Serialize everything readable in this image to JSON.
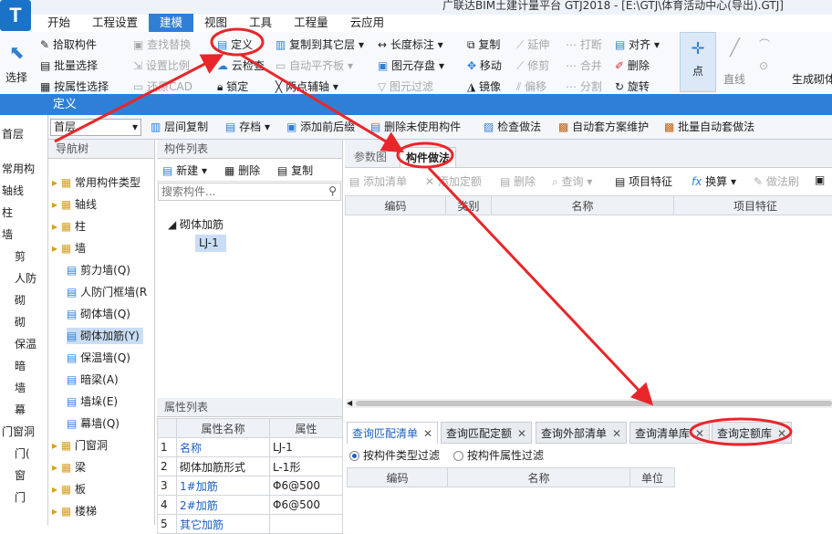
{
  "app": {
    "title_text": "广联达BIM土建计量平台 GTJ2018 - [E:\\GTJ\\体育活动中心(导出).GTJ]",
    "logo_letter": "T"
  },
  "menu": [
    "开始",
    "工程设置",
    "建模",
    "视图",
    "工具",
    "工程量",
    "云应用"
  ],
  "menu_active_index": 2,
  "ribbon": {
    "select_label": "选择",
    "pick_component": "拾取构件",
    "batch_select": "批量选择",
    "select_by_attr": "按属性选择",
    "find_replace": "查找替换",
    "define": "定义",
    "set_ratio": "设置比例",
    "cloud_check": "云检查",
    "restore_cad": "还原CAD",
    "lock": "锁定",
    "copy_to_floor": "复制到其它层",
    "auto_level_board": "自动平齐板",
    "two_point_axis": "两点辅轴",
    "length_mark": "长度标注",
    "element_save": "图元存盘",
    "element_filter": "图元过滤",
    "copy": "复制",
    "extend": "延伸",
    "break": "打断",
    "align": "对齐",
    "move": "移动",
    "trim": "修剪",
    "merge": "合并",
    "delete": "删除",
    "mirror": "镜像",
    "offset": "偏移",
    "split": "分割",
    "rotate": "旋转",
    "point": "点",
    "line": "直线",
    "gen_masonry": "生成砌体"
  },
  "define_bar": "定义",
  "toolbar": {
    "floor": "首层",
    "layer_copy": "层间复制",
    "archive": "存档",
    "add_prefix": "添加前后缀",
    "delete_unused": "删除未使用构件",
    "check_method": "检查做法",
    "auto_scheme": "自动套方案维护",
    "batch_auto": "批量自动套做法"
  },
  "bg_left": [
    "首层",
    "常用构",
    "轴线",
    "柱",
    "墙",
    "剪",
    "人防",
    "砌",
    "砌",
    "保温",
    "暗",
    "墙",
    "幕",
    "门窗洞",
    "门(",
    "窗",
    "门"
  ],
  "nav": {
    "title": "导航树",
    "items": [
      {
        "label": "常用构件类型",
        "level": 0
      },
      {
        "label": "轴线",
        "level": 0
      },
      {
        "label": "柱",
        "level": 0
      },
      {
        "label": "墙",
        "level": 0
      },
      {
        "label": "剪力墙(Q)",
        "level": 1
      },
      {
        "label": "人防门框墙(R",
        "level": 1
      },
      {
        "label": "砌体墙(Q)",
        "level": 1
      },
      {
        "label": "砌体加筋(Y)",
        "level": 1
      },
      {
        "label": "保温墙(Q)",
        "level": 1
      },
      {
        "label": "暗梁(A)",
        "level": 1
      },
      {
        "label": "墙垛(E)",
        "level": 1
      },
      {
        "label": "幕墙(Q)",
        "level": 1
      },
      {
        "label": "门窗洞",
        "level": 0
      },
      {
        "label": "梁",
        "level": 0
      },
      {
        "label": "板",
        "level": 0
      },
      {
        "label": "楼梯",
        "level": 0
      }
    ],
    "selected_index": 7
  },
  "components": {
    "title": "构件列表",
    "new": "新建",
    "delete": "删除",
    "copy": "复制",
    "search_placeholder": "搜索构件...",
    "group": "砌体加筋",
    "item": "LJ-1"
  },
  "attributes": {
    "title": "属性列表",
    "col_name": "属性名称",
    "col_value": "属性",
    "rows": [
      {
        "no": "1",
        "name": "名称",
        "value": "LJ-1",
        "blue": true
      },
      {
        "no": "2",
        "name": "砌体加筋形式",
        "value": "L-1形",
        "blue": false
      },
      {
        "no": "3",
        "name": "1#加筋",
        "value": "Φ6@500",
        "blue": true
      },
      {
        "no": "4",
        "name": "2#加筋",
        "value": "Φ6@500",
        "blue": true
      },
      {
        "no": "5",
        "name": "其它加筋",
        "value": "",
        "blue": true
      }
    ]
  },
  "right": {
    "tab_params": "参数图",
    "tab_method": "构件做法",
    "add_list": "添加清单",
    "add_quota": "添加定额",
    "delete": "删除",
    "query": "查询",
    "item_feature": "项目特征",
    "convert": "换算",
    "method_brush": "做法刷",
    "cols": [
      "编码",
      "类别",
      "名称",
      "项目特征"
    ]
  },
  "bottom": {
    "tabs": [
      "查询匹配清单",
      "查询匹配定额",
      "查询外部清单",
      "查询清单库",
      "查询定额库"
    ],
    "active_index": 0,
    "radio_type": "按构件类型过滤",
    "radio_attr": "按构件属性过滤",
    "cols": [
      "编码",
      "名称",
      "单位"
    ]
  },
  "colors": {
    "accent": "#2f7fd6",
    "annotation": "#e8262a"
  }
}
